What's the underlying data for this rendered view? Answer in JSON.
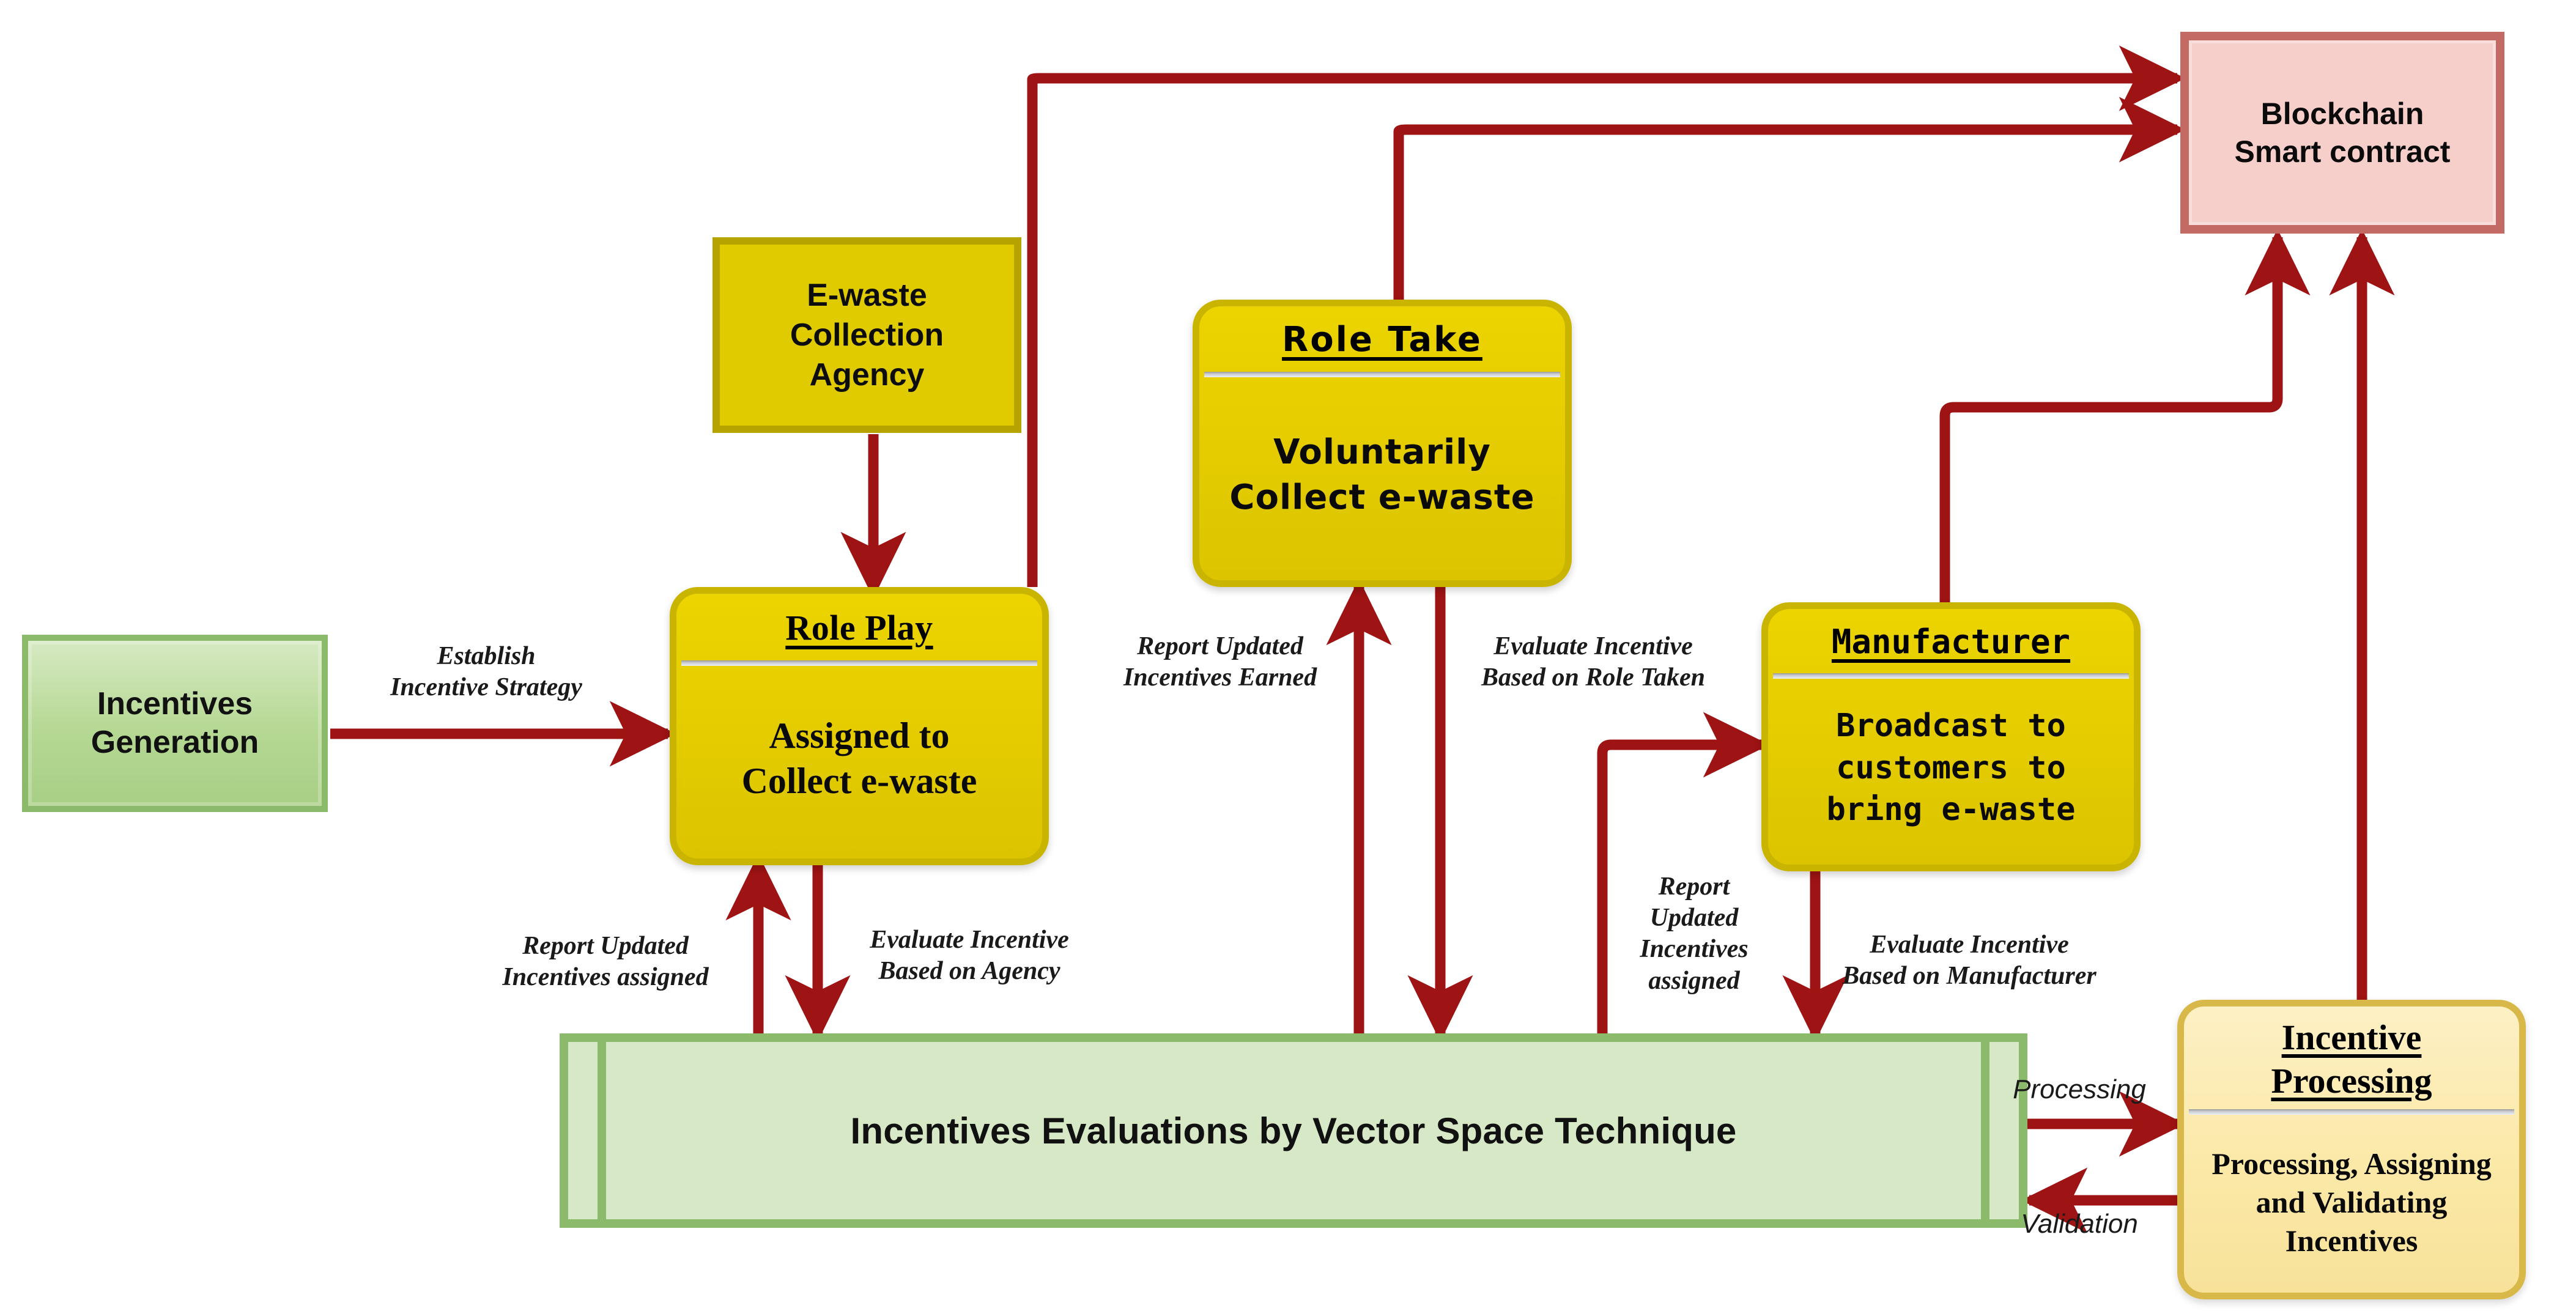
{
  "diagram": {
    "title": "E-waste Incentive Generation and Evaluation Flow",
    "accent_arrow_color": "#9e1313",
    "colors": {
      "green_fill": "#b5d893",
      "green_border": "#8cba6b",
      "yellow_fill": "#e0ca00",
      "yellow_border": "#b7a300",
      "card_fill": "#e6ce00",
      "card_border": "#c9b400",
      "pink_fill": "#f6cfcb",
      "pink_border": "#c26a63",
      "cream_fill": "#fbe9a8",
      "cream_border": "#d9b84a",
      "band_fill": "#d7e8c6",
      "band_border": "#8cba6b",
      "arrow": "#9e1313"
    }
  },
  "nodes": {
    "incentives_generation": {
      "label": "Incentives\nGeneration"
    },
    "collection_agency": {
      "label": "E-waste\nCollection\nAgency"
    },
    "role_play": {
      "title": "Role Play",
      "body": "Assigned to\nCollect e-waste"
    },
    "role_take": {
      "title": "Role  Take",
      "body": "Voluntarily\nCollect e-waste"
    },
    "manufacturer": {
      "title": "Manufacturer",
      "body": "Broadcast to\ncustomers to\nbring e-waste"
    },
    "blockchain": {
      "label": "Blockchain\nSmart contract"
    },
    "incentive_processing": {
      "title": "Incentive\nProcessing",
      "body": "Processing, Assigning\nand Validating\nIncentives"
    },
    "evaluation_band": {
      "label": "Incentives Evaluations by Vector Space Technique"
    }
  },
  "edge_labels": {
    "establish_strategy": "Establish\nIncentive Strategy",
    "report_assigned_left": "Report Updated\nIncentives assigned",
    "evaluate_agency": "Evaluate Incentive\nBased on Agency",
    "report_earned": "Report Updated\nIncentives Earned",
    "evaluate_role_taken": "Evaluate Incentive\nBased on Role Taken",
    "report_assigned_right": "Report\nUpdated\nIncentives\nassigned",
    "evaluate_manufacturer": "Evaluate Incentive\nBased on Manufacturer",
    "processing": "Processing",
    "validation": "Validation"
  }
}
